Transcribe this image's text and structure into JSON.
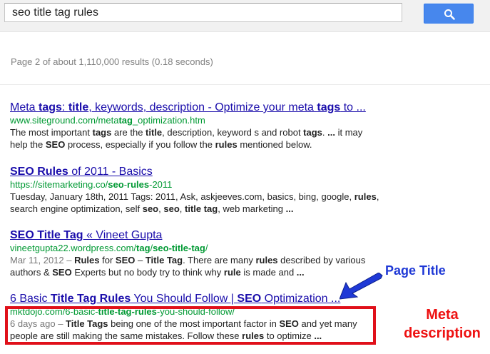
{
  "search": {
    "query": "seo title tag rules"
  },
  "stats": {
    "text": "Page 2 of about 1,110,000 results (0.18 seconds)"
  },
  "results": [
    {
      "title": [
        {
          "t": "Meta ",
          "b": false
        },
        {
          "t": "tags",
          "b": true
        },
        {
          "t": ": ",
          "b": false
        },
        {
          "t": "title",
          "b": true
        },
        {
          "t": ", keywords, description - Optimize your meta ",
          "b": false
        },
        {
          "t": "tags",
          "b": true
        },
        {
          "t": " to ...",
          "b": false
        }
      ],
      "url": [
        {
          "t": "www.siteground.com/meta",
          "b": false
        },
        {
          "t": "tag",
          "b": true
        },
        {
          "t": "_optimization.htm",
          "b": false
        }
      ],
      "snippet": [
        {
          "t": "The most important ",
          "b": false
        },
        {
          "t": "tags",
          "b": true
        },
        {
          "t": " are the ",
          "b": false
        },
        {
          "t": "title",
          "b": true
        },
        {
          "t": ", description, keyword s and robot ",
          "b": false
        },
        {
          "t": "tags",
          "b": true
        },
        {
          "t": ". ",
          "b": false
        },
        {
          "t": "...",
          "b": true
        },
        {
          "t": " it may help the ",
          "b": false
        },
        {
          "t": "SEO",
          "b": true
        },
        {
          "t": " process, especially if you follow the ",
          "b": false
        },
        {
          "t": "rules",
          "b": true
        },
        {
          "t": " mentioned below.",
          "b": false
        }
      ]
    },
    {
      "title": [
        {
          "t": "SEO Rules",
          "b": true
        },
        {
          "t": " of 2011 - Basics",
          "b": false
        }
      ],
      "url": [
        {
          "t": "https://sitemarketing.co/",
          "b": false
        },
        {
          "t": "seo",
          "b": true
        },
        {
          "t": "-",
          "b": false
        },
        {
          "t": "rules",
          "b": true
        },
        {
          "t": "-2011",
          "b": false
        }
      ],
      "snippet": [
        {
          "t": "Tuesday, January 18th, 2011 Tags: 2011, Ask, askjeeves.com, basics, bing, google, ",
          "b": false
        },
        {
          "t": "rules",
          "b": true
        },
        {
          "t": ", search engine optimization, self ",
          "b": false
        },
        {
          "t": "seo",
          "b": true
        },
        {
          "t": ", ",
          "b": false
        },
        {
          "t": "seo",
          "b": true
        },
        {
          "t": ", ",
          "b": false
        },
        {
          "t": "title tag",
          "b": true
        },
        {
          "t": ", web marketing ",
          "b": false
        },
        {
          "t": "...",
          "b": true
        }
      ]
    },
    {
      "title": [
        {
          "t": "SEO Title Tag",
          "b": true
        },
        {
          "t": " « Vineet Gupta",
          "b": false
        }
      ],
      "url": [
        {
          "t": "vineetgupta22.wordpress.com/",
          "b": false
        },
        {
          "t": "tag",
          "b": true
        },
        {
          "t": "/",
          "b": false
        },
        {
          "t": "seo-title-tag",
          "b": true
        },
        {
          "t": "/",
          "b": false
        }
      ],
      "date": "Mar 11, 2012 – ",
      "snippet": [
        {
          "t": "Rules",
          "b": true
        },
        {
          "t": " for ",
          "b": false
        },
        {
          "t": "SEO",
          "b": true
        },
        {
          "t": " – ",
          "b": false
        },
        {
          "t": "Title Tag",
          "b": true
        },
        {
          "t": ". There are many ",
          "b": false
        },
        {
          "t": "rules",
          "b": true
        },
        {
          "t": " described by various authors & ",
          "b": false
        },
        {
          "t": "SEO",
          "b": true
        },
        {
          "t": " Experts but no body try to think why ",
          "b": false
        },
        {
          "t": "rule",
          "b": true
        },
        {
          "t": " is made and ",
          "b": false
        },
        {
          "t": "...",
          "b": true
        }
      ]
    },
    {
      "title": [
        {
          "t": "6 Basic ",
          "b": false
        },
        {
          "t": "Title Tag Rules",
          "b": true
        },
        {
          "t": " You Should Follow | ",
          "b": false
        },
        {
          "t": "SEO",
          "b": true
        },
        {
          "t": " Optimization ...",
          "b": false
        }
      ],
      "url": [
        {
          "t": "mktdojo.com/6-basic-",
          "b": false
        },
        {
          "t": "title-tag-rules",
          "b": true
        },
        {
          "t": "-you-should-follow/",
          "b": false
        }
      ],
      "date": "6 days ago – ",
      "snippet": [
        {
          "t": "Title Tags",
          "b": true
        },
        {
          "t": " being one of the most important factor in ",
          "b": false
        },
        {
          "t": "SEO",
          "b": true
        },
        {
          "t": " and yet many people are still making the same mistakes. Follow these ",
          "b": false
        },
        {
          "t": "rules",
          "b": true
        },
        {
          "t": " to optimize ",
          "b": false
        },
        {
          "t": "...",
          "b": true
        }
      ]
    }
  ],
  "annotations": {
    "page_title": "Page Title",
    "meta_line1": "Meta",
    "meta_line2": "description",
    "arrow_color": "#1f39d6",
    "box_color": "#e0101a"
  },
  "icons": {
    "search_button": "search-icon",
    "arrow": "arrow-icon"
  }
}
